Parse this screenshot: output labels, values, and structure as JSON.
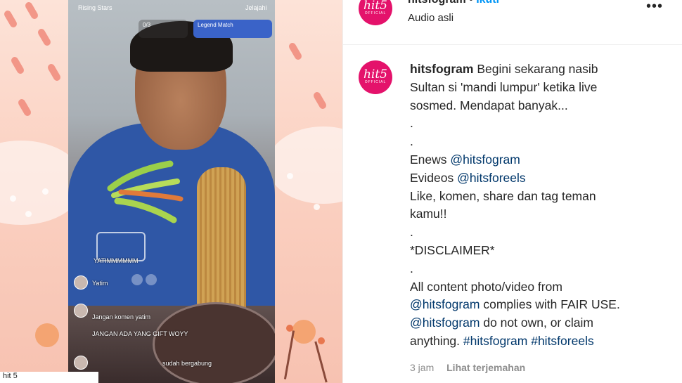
{
  "media": {
    "live": {
      "top_left": "Rising Stars",
      "top_right": "Jelajahi",
      "counter": "0/3",
      "match_title": "Legend Match",
      "comments": [
        {
          "user": "YATIMMMMMM",
          "text": ""
        },
        {
          "user": "Yatim",
          "text": ""
        },
        {
          "user": "",
          "text": "Jangan komen yatim"
        },
        {
          "user": "",
          "text": "JANGAN ADA YANG GIFT WOYY"
        },
        {
          "user": "",
          "text": "sudah bergabung"
        }
      ]
    },
    "bottom_label": "hit 5"
  },
  "post": {
    "header": {
      "avatar_logo": "hit5",
      "avatar_sub": "OFFICIAL",
      "username": "hitsfogram",
      "separator": "•",
      "follow_label": "Ikuti",
      "audio": "Audio asli",
      "more_icon": "more-icon"
    },
    "caption": {
      "username": "hitsfogram",
      "line1": "Begini sekarang nasib",
      "line2": "Sultan si 'mandi lumpur' ketika live",
      "line3": "sosmed. Mendapat banyak...",
      "dot1": ".",
      "dot2": ".",
      "enews_label": "Enews",
      "enews_handle": "@hitsfogram",
      "evideos_label": "Evideos",
      "evideos_handle": "@hitsforeels",
      "like_line1": "Like, komen, share dan tag teman",
      "like_line2": "kamu!!",
      "dot3": ".",
      "disclaimer": "*DISCLAIMER*",
      "dot4": ".",
      "body_line1": "All content photo/video from",
      "body_handle1": "@hitsfogram",
      "body_line2_rest": "complies with FAIR USE.",
      "body_handle2": "@hitsfogram",
      "body_line3_rest": "do not own, or claim",
      "body_line4_start": "anything.",
      "hashtag1": "#hitsfogram",
      "hashtag2": "#hitsforeels"
    },
    "meta": {
      "time": "3 jam",
      "translate": "Lihat terjemahan"
    }
  },
  "colors": {
    "brand": "#e4126b",
    "link": "#00376b",
    "follow": "#0095f6",
    "muted": "#8e8e8e"
  }
}
